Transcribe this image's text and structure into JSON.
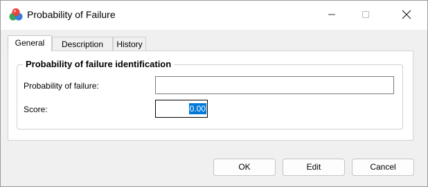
{
  "window": {
    "title": "Probability of Failure",
    "app_icon": "colored-spheres-icon",
    "controls": {
      "minimize": "minimize-icon",
      "maximize": "maximize-icon",
      "close": "close-icon"
    }
  },
  "tabs": [
    {
      "label": "General",
      "active": true
    },
    {
      "label": "Description",
      "active": false
    },
    {
      "label": "History",
      "active": false
    }
  ],
  "group": {
    "title": "Probability of failure identification",
    "fields": {
      "probability_label": "Probability of failure:",
      "probability_value": "",
      "score_label": "Score:",
      "score_value": "0.00"
    }
  },
  "buttons": {
    "ok": "OK",
    "edit": "Edit",
    "cancel": "Cancel"
  },
  "colors": {
    "selection": "#0078d7",
    "app_icon_red": "#e8453c",
    "app_icon_green": "#3aa757",
    "app_icon_blue": "#3b7ddd"
  }
}
